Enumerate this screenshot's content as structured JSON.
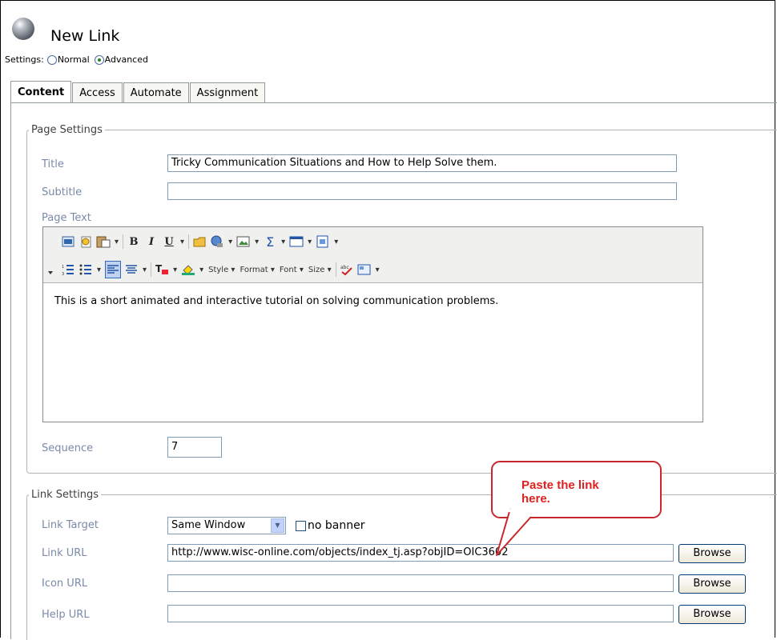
{
  "header": {
    "title": "New Link"
  },
  "settings": {
    "label": "Settings:",
    "options": [
      "Normal",
      "Advanced"
    ],
    "selected": "Advanced"
  },
  "tabs": [
    {
      "label": "Content",
      "active": true
    },
    {
      "label": "Access",
      "active": false
    },
    {
      "label": "Automate",
      "active": false
    },
    {
      "label": "Assignment",
      "active": false
    }
  ],
  "page_settings": {
    "legend": "Page Settings",
    "title_label": "Title",
    "title_value": "Tricky Communication Situations and How to Help Solve them.",
    "subtitle_label": "Subtitle",
    "subtitle_value": "",
    "page_text_label": "Page Text",
    "editor": {
      "toolbar_row1": [
        "source-icon",
        "paste-word-icon",
        "paste-icon",
        "bold-icon",
        "italic-icon",
        "underline-icon",
        "link-icon",
        "anchor-icon",
        "image-icon",
        "sigma-icon",
        "table-icon",
        "template-icon"
      ],
      "toolbar_row2": [
        "ordered-list-icon",
        "bullet-list-icon",
        "align-left-icon",
        "align-center-icon",
        "text-color-icon",
        "bg-color-icon"
      ],
      "style_label": "Style",
      "format_label": "Format",
      "font_label": "Font",
      "size_label": "Size",
      "content": "This is a short animated and interactive tutorial on solving communication problems."
    },
    "sequence_label": "Sequence",
    "sequence_value": "7"
  },
  "link_settings": {
    "legend": "Link Settings",
    "target_label": "Link Target",
    "target_value": "Same Window",
    "no_banner_label": "no banner",
    "url_label": "Link URL",
    "url_value": "http://www.wisc-online.com/objects/index_tj.asp?objID=OIC3602",
    "icon_label": "Icon URL",
    "icon_value": "",
    "help_label": "Help URL",
    "help_value": "",
    "browse_label": "Browse"
  },
  "callout": {
    "line1": "Paste the link",
    "line2": "here.",
    "color": "#e02020"
  }
}
